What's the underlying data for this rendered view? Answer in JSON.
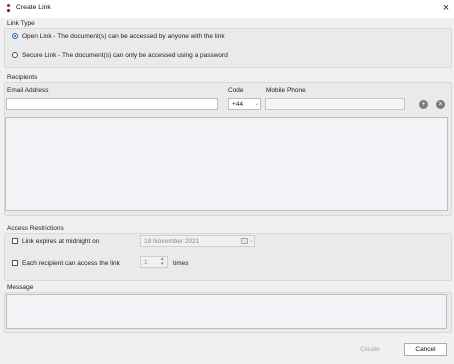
{
  "window": {
    "title": "Create Link",
    "close_glyph": "×"
  },
  "link_type": {
    "label": "Link Type",
    "options": [
      {
        "label": "Open Link - The document(s) can be accessed by anyone with the link",
        "selected": true
      },
      {
        "label": "Secure Link - The document(s) can only be accessed using a password",
        "selected": false
      }
    ]
  },
  "recipients": {
    "label": "Recipients",
    "email_label": "Email Address",
    "email_value": "",
    "code_label": "Code",
    "code_value": "+44",
    "mobile_label": "Mobile Phone",
    "mobile_value": "",
    "add_glyph": "+",
    "remove_glyph": "×",
    "list": []
  },
  "access_restrictions": {
    "label": "Access Restrictions",
    "expires": {
      "label": "Link expires at midnight on",
      "checked": false,
      "date": "18 November 2021"
    },
    "access_count": {
      "label": "Each recipient can access the link",
      "checked": false,
      "value": "1",
      "suffix": "times"
    }
  },
  "message": {
    "label": "Message",
    "value": ""
  },
  "buttons": {
    "create": "Create",
    "cancel": "Cancel"
  },
  "icons": {
    "app": "app-logo-icon",
    "close": "close-icon",
    "calendar": "calendar-icon",
    "add": "add-circle-icon",
    "remove": "remove-circle-icon"
  },
  "colors": {
    "accent": "#1a5fb4",
    "logo": "#c8102e"
  }
}
